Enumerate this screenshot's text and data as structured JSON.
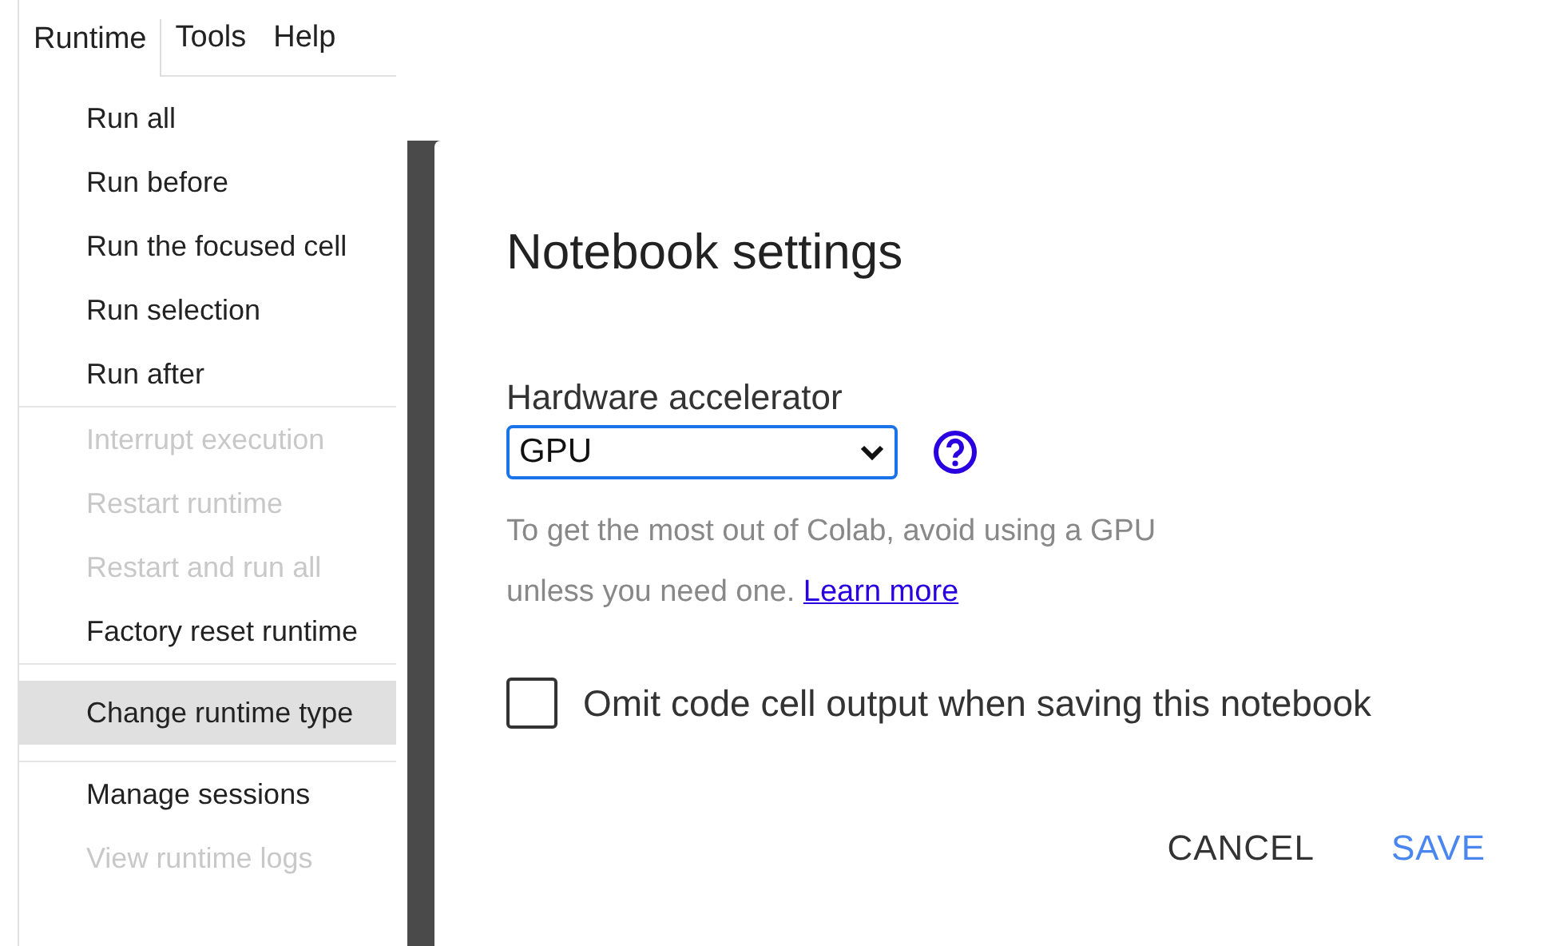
{
  "menubar": [
    {
      "label": "Runtime",
      "selected": true
    },
    {
      "label": "Tools",
      "selected": false
    },
    {
      "label": "Help",
      "selected": false
    }
  ],
  "menu": {
    "sections": [
      {
        "items": [
          {
            "label": "Run all",
            "disabled": false,
            "selected": false
          },
          {
            "label": "Run before",
            "disabled": false,
            "selected": false
          },
          {
            "label": "Run the focused cell",
            "disabled": false,
            "selected": false
          },
          {
            "label": "Run selection",
            "disabled": false,
            "selected": false
          },
          {
            "label": "Run after",
            "disabled": false,
            "selected": false
          }
        ]
      },
      {
        "items": [
          {
            "label": "Interrupt execution",
            "disabled": true,
            "selected": false
          },
          {
            "label": "Restart runtime",
            "disabled": true,
            "selected": false
          },
          {
            "label": "Restart and run all",
            "disabled": true,
            "selected": false
          },
          {
            "label": "Factory reset runtime",
            "disabled": false,
            "selected": false
          }
        ]
      },
      {
        "items": [
          {
            "label": "Change runtime type",
            "disabled": false,
            "selected": true
          }
        ]
      },
      {
        "items": [
          {
            "label": "Manage sessions",
            "disabled": false,
            "selected": false
          },
          {
            "label": "View runtime logs",
            "disabled": true,
            "selected": false
          }
        ]
      }
    ]
  },
  "dialog": {
    "title": "Notebook settings",
    "field_label": "Hardware accelerator",
    "select_value": "GPU",
    "hint": "To get the most out of Colab, avoid using a GPU unless you need one.",
    "link": "Learn more",
    "checkbox": {
      "label": "Omit code cell output when saving this notebook",
      "checked": false
    },
    "buttons": [
      "CANCEL",
      "SAVE"
    ]
  }
}
